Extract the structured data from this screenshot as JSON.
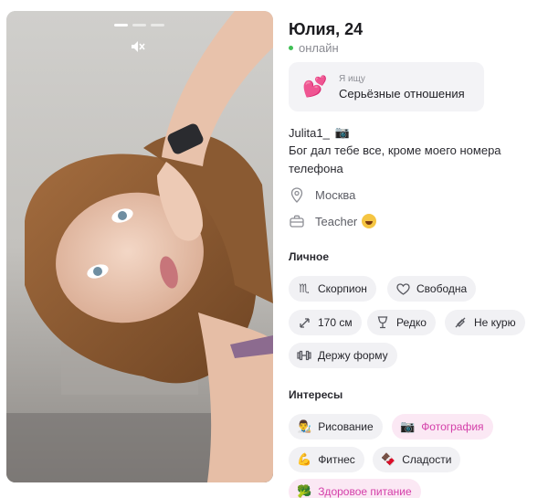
{
  "profile": {
    "name_age": "Юлия, 24",
    "status": "онлайн",
    "looking_for": {
      "label": "Я ищу",
      "value": "Серьёзные отношения"
    },
    "username": "Julita1_",
    "bio": "Бог дал тебе все, кроме моего номера телефона",
    "city": "Москва",
    "job": "Teacher"
  },
  "photo": {
    "icon": "mute-icon",
    "slides": 3,
    "active_slide": 1
  },
  "personal": {
    "title": "Личное",
    "items": [
      {
        "label": "Скорпион",
        "icon": "scorpio-icon"
      },
      {
        "label": "Свободна",
        "icon": "heart-outline-icon"
      },
      {
        "label": "170 см",
        "icon": "height-arrow-icon"
      },
      {
        "label": "Редко",
        "icon": "wine-glass-icon"
      },
      {
        "label": "Не курю",
        "icon": "no-smoking-icon"
      },
      {
        "label": "Держу форму",
        "icon": "dumbbell-icon"
      }
    ]
  },
  "interests": {
    "title": "Интересы",
    "items": [
      {
        "label": "Рисование",
        "emoji": "👨‍🎨",
        "highlight": false
      },
      {
        "label": "Фотография",
        "emoji": "📷",
        "highlight": true
      },
      {
        "label": "Фитнес",
        "emoji": "💪",
        "highlight": false
      },
      {
        "label": "Сладости",
        "emoji": "🍫",
        "highlight": false
      },
      {
        "label": "Здоровое питание",
        "emoji": "🥦",
        "highlight": true
      }
    ]
  },
  "colors": {
    "online_dot": "#3fbf55",
    "highlight_text": "#d43fa9",
    "highlight_bg": "#fbe8f4",
    "chip_bg": "#f1f1f4"
  }
}
